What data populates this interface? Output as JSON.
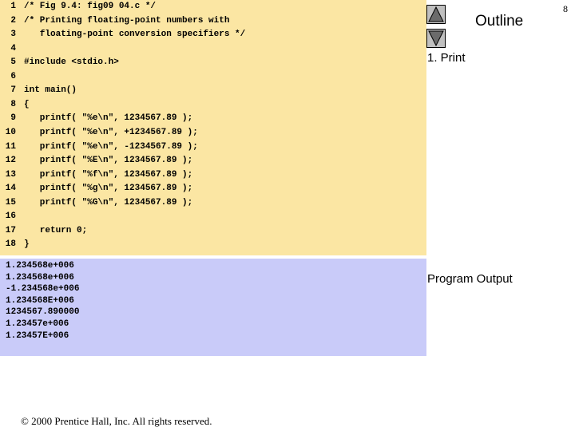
{
  "code_lines": [
    {
      "num": "1",
      "text": "/* Fig 9.4: fig09 04.c */"
    },
    {
      "num": "2",
      "text": "/* Printing floating-point numbers with"
    },
    {
      "num": "3",
      "text": "   floating-point conversion specifiers */"
    },
    {
      "num": "4",
      "text": ""
    },
    {
      "num": "5",
      "text": "#include <stdio.h>"
    },
    {
      "num": "6",
      "text": ""
    },
    {
      "num": "7",
      "text": "int main()"
    },
    {
      "num": "8",
      "text": "{"
    },
    {
      "num": "9",
      "text": "   printf( \"%e\\n\", 1234567.89 );"
    },
    {
      "num": "10",
      "text": "   printf( \"%e\\n\", +1234567.89 );"
    },
    {
      "num": "11",
      "text": "   printf( \"%e\\n\", -1234567.89 );"
    },
    {
      "num": "12",
      "text": "   printf( \"%E\\n\", 1234567.89 );"
    },
    {
      "num": "13",
      "text": "   printf( \"%f\\n\", 1234567.89 );"
    },
    {
      "num": "14",
      "text": "   printf( \"%g\\n\", 1234567.89 );"
    },
    {
      "num": "15",
      "text": "   printf( \"%G\\n\", 1234567.89 );"
    },
    {
      "num": "16",
      "text": ""
    },
    {
      "num": "17",
      "text": "   return 0;"
    },
    {
      "num": "18",
      "text": "}"
    }
  ],
  "output_lines": [
    "1.234568e+006",
    "1.234568e+006",
    "-1.234568e+006",
    "1.234568E+006",
    "1234567.890000",
    "1.23457e+006",
    "1.23457E+006"
  ],
  "sidebar": {
    "outline_title": "Outline",
    "print_label": "1. Print",
    "output_label": "Program Output"
  },
  "page_number": "8",
  "copyright": "© 2000 Prentice Hall, Inc.  All rights reserved.",
  "colors": {
    "code_bg": "#fbe6a3",
    "output_bg": "#c9cbf9",
    "button_bg": "#c0c0c0"
  },
  "icons": {
    "up": "triangle-up-icon",
    "down": "triangle-down-icon"
  }
}
